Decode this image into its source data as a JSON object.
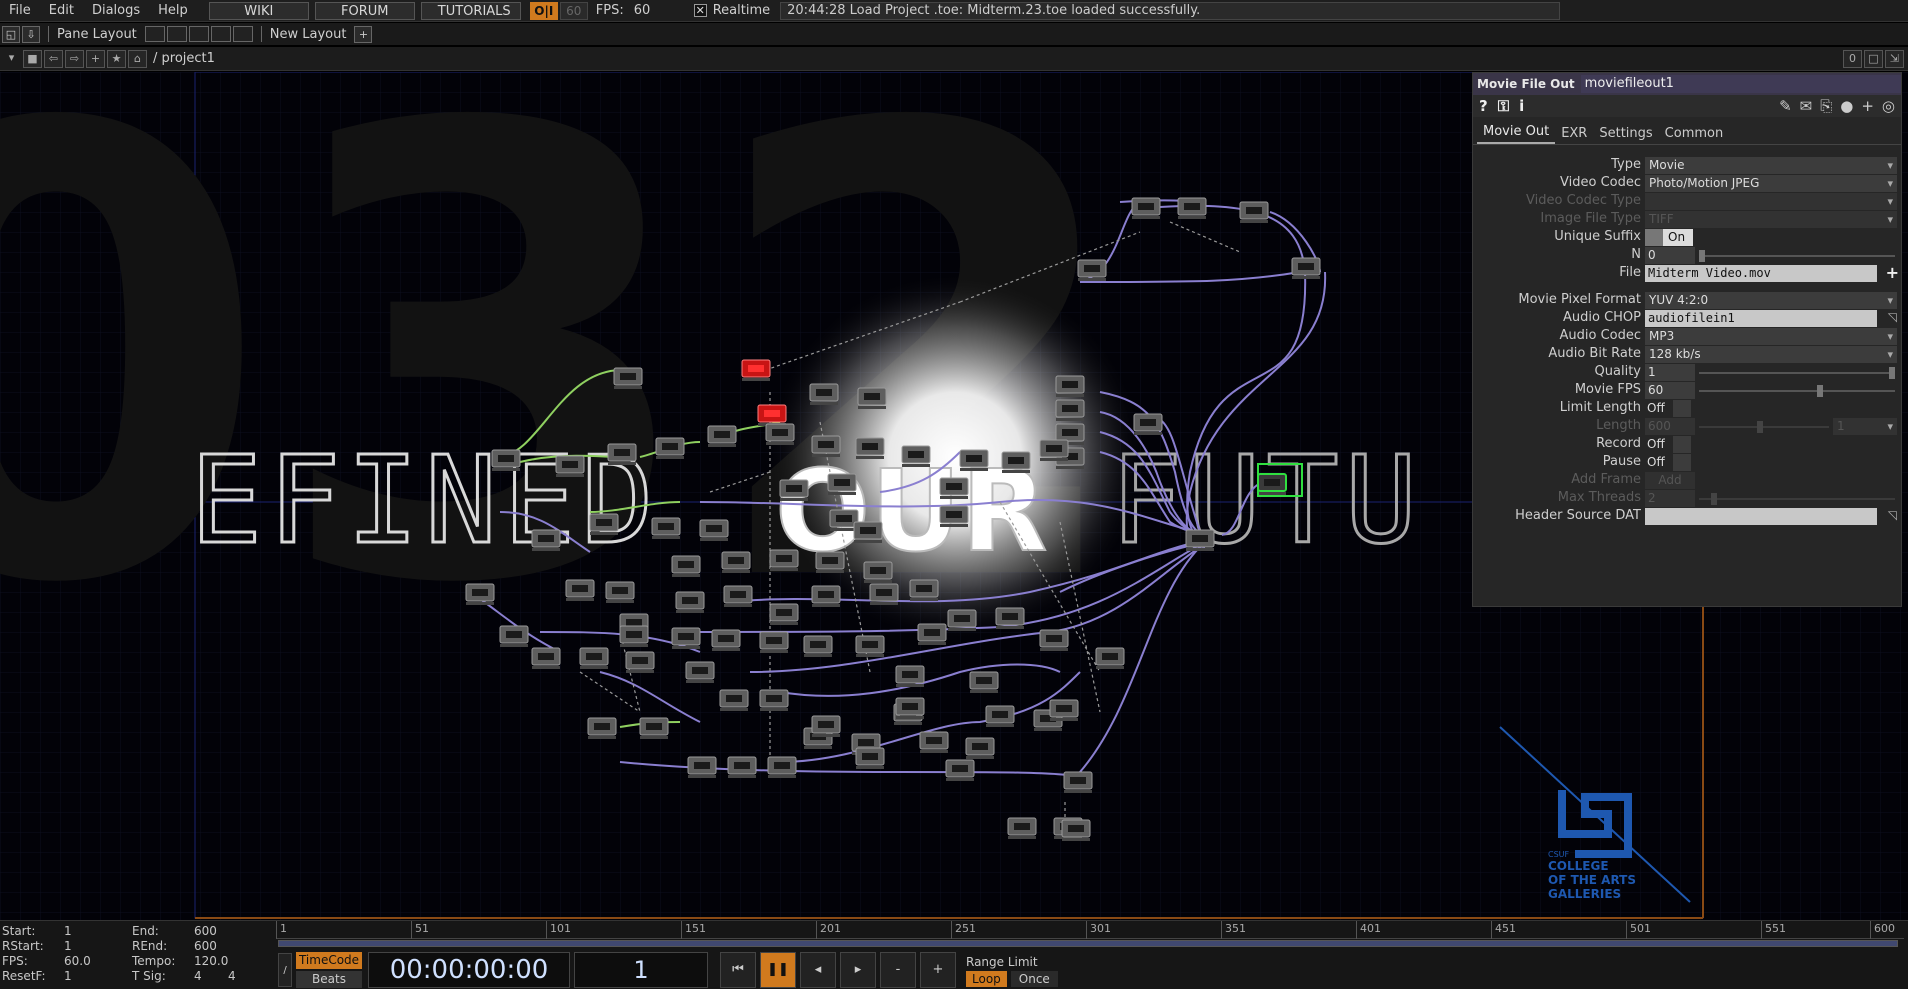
{
  "menu": {
    "items": [
      "File",
      "Edit",
      "Dialogs",
      "Help"
    ],
    "links": [
      "WIKI",
      "FORUM",
      "TUTORIALS"
    ],
    "oi": "O|I",
    "fps_cap": "60",
    "fps_label": "FPS:",
    "fps_value": "60",
    "realtime_check": "✕",
    "realtime_label": "Realtime",
    "status": "20:44:28 Load Project .toe: Midterm.23.toe loaded successfully."
  },
  "layout": {
    "pane_layout": "Pane Layout",
    "new_layout": "New Layout",
    "plus": "+"
  },
  "path": {
    "text": "/ project1",
    "right_value": "0"
  },
  "network": {
    "background_text": {
      "big": "032",
      "left": "EFINED ",
      "mid": "OUR",
      "right": " FUTU"
    },
    "watermark": {
      "org_small": "CSUF",
      "line1": "COLLEGE",
      "line2": "OF THE ARTS",
      "line3": "GALLERIES"
    }
  },
  "params": {
    "op_type": "Movie File Out",
    "op_name": "moviefileout1",
    "icons": [
      "help-icon",
      "python-help-icon",
      "info-icon"
    ],
    "tabs": [
      "Movie Out",
      "EXR",
      "Settings",
      "Common"
    ],
    "active_tab": "Movie Out",
    "rows": {
      "type": {
        "label": "Type",
        "value": "Movie"
      },
      "video_codec": {
        "label": "Video Codec",
        "value": "Photo/Motion JPEG"
      },
      "video_codec_type": {
        "label": "Video Codec Type",
        "value": ""
      },
      "image_file_type": {
        "label": "Image File Type",
        "value": "TIFF"
      },
      "unique_suffix": {
        "label": "Unique Suffix",
        "value": "On"
      },
      "n": {
        "label": "N",
        "value": "0"
      },
      "file": {
        "label": "File",
        "value": "Midterm Video.mov"
      },
      "pixel_format": {
        "label": "Movie Pixel Format",
        "value": "YUV 4:2:0"
      },
      "audio_chop": {
        "label": "Audio CHOP",
        "value": "audiofilein1"
      },
      "audio_codec": {
        "label": "Audio Codec",
        "value": "MP3"
      },
      "audio_bitrate": {
        "label": "Audio Bit Rate",
        "value": "128 kb/s"
      },
      "quality": {
        "label": "Quality",
        "value": "1"
      },
      "movie_fps": {
        "label": "Movie FPS",
        "value": "60"
      },
      "limit_length": {
        "label": "Limit Length",
        "value": "Off"
      },
      "length": {
        "label": "Length",
        "value": "600",
        "unit": "1"
      },
      "record": {
        "label": "Record",
        "value": "Off"
      },
      "pause": {
        "label": "Pause",
        "value": "Off"
      },
      "add_frame": {
        "label": "Add Frame",
        "value": "Add"
      },
      "max_threads": {
        "label": "Max Threads",
        "value": "2"
      },
      "header_source": {
        "label": "Header Source DAT",
        "value": ""
      }
    }
  },
  "timeline": {
    "info": {
      "start_label": "Start:",
      "start": "1",
      "end_label": "End:",
      "end": "600",
      "rstart_label": "RStart:",
      "rstart": "1",
      "rend_label": "REnd:",
      "rend": "600",
      "fps_label": "FPS:",
      "fps": "60.0",
      "tempo_label": "Tempo:",
      "tempo": "120.0",
      "resetf_label": "ResetF:",
      "resetf": "1",
      "tsig_label": "T Sig:",
      "tsig_a": "4",
      "tsig_b": "4"
    },
    "ticks": [
      "1",
      "51",
      "101",
      "151",
      "201",
      "251",
      "301",
      "351",
      "401",
      "451",
      "501",
      "551",
      "600"
    ],
    "timecode_label": "TimeCode",
    "beats_label": "Beats",
    "timecode": "00:00:00:00",
    "frame": "1",
    "range_label": "Range Limit",
    "loop_label": "Loop",
    "once_label": "Once"
  },
  "colors": {
    "accent_orange": "#d07a1e",
    "wire_purple": "#8a7fd0",
    "wire_green": "#8fd060",
    "node_gray": "#6a6a6a",
    "node_red": "#d01818",
    "watermark_blue": "#1e58b0"
  }
}
